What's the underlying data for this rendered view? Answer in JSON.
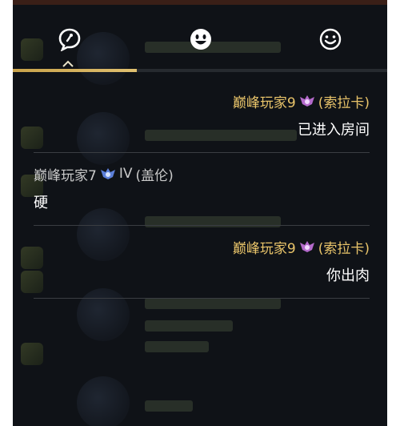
{
  "tabs": [
    {
      "name": "chat",
      "icon": "chat-bubble-icon",
      "active": true
    },
    {
      "name": "emote",
      "icon": "emote-face-icon",
      "active": false
    },
    {
      "name": "smiley",
      "icon": "smiley-icon",
      "active": false
    }
  ],
  "messages": [
    {
      "align": "right",
      "player": "巅峰玩家9",
      "rank_tier": "",
      "champion": "(索拉卡)",
      "text": "已进入房间"
    },
    {
      "align": "left",
      "player": "巅峰玩家7",
      "rank_tier": "IV",
      "champion": "(盖伦)",
      "text": "硬"
    },
    {
      "align": "right",
      "player": "巅峰玩家9",
      "rank_tier": "",
      "champion": "(索拉卡)",
      "text": "你出肉"
    }
  ],
  "colors": {
    "accent_gold": "#e9c46a",
    "panel_bg": "#0f1217",
    "divider": "#3a3d42",
    "badge_purple": "#b46acb",
    "badge_blue": "#5c7fd9"
  }
}
